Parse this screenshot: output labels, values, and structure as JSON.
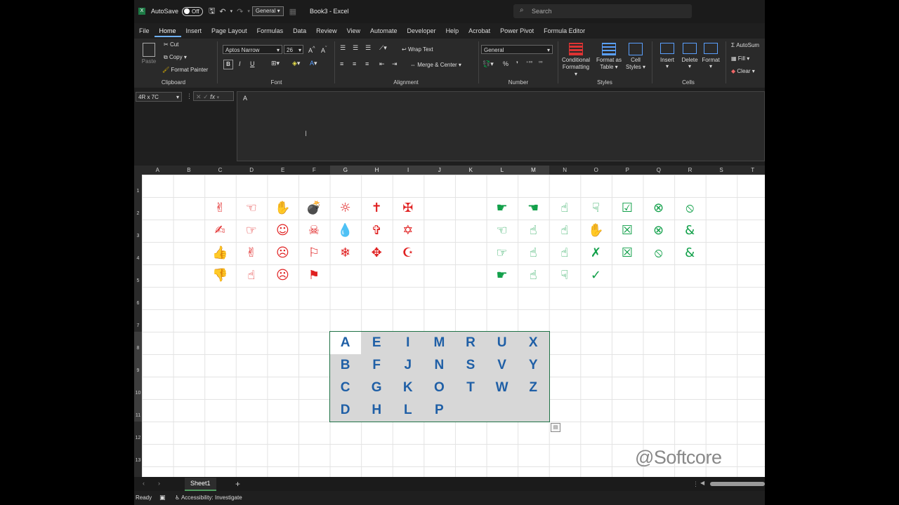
{
  "titlebar": {
    "autosave_label": "AutoSave",
    "autosave_state": "Off",
    "number_format_dropdown": "General",
    "title": "Book3 - Excel",
    "search_placeholder": "Search"
  },
  "menu_tabs": [
    "File",
    "Home",
    "Insert",
    "Page Layout",
    "Formulas",
    "Data",
    "Review",
    "View",
    "Automate",
    "Developer",
    "Help",
    "Acrobat",
    "Power Pivot",
    "Formula Editor"
  ],
  "ribbon": {
    "clipboard": {
      "paste": "Paste",
      "cut": "Cut",
      "copy": "Copy",
      "format_painter": "Format Painter",
      "label": "Clipboard"
    },
    "font": {
      "name": "Aptos Narrow",
      "size": "26",
      "bold": "B",
      "italic": "I",
      "underline": "U",
      "label": "Font"
    },
    "alignment": {
      "wrap": "Wrap Text",
      "merge": "Merge & Center",
      "label": "Alignment"
    },
    "number": {
      "format": "General",
      "label": "Number"
    },
    "styles": {
      "conditional": "Conditional Formatting",
      "format_table": "Format as Table",
      "cell_styles": "Cell Styles",
      "label": "Styles"
    },
    "cells": {
      "insert": "Insert",
      "delete": "Delete",
      "format": "Format",
      "label": "Cells"
    },
    "editing": {
      "autosum": "AutoSum",
      "fill": "Fill",
      "clear": "Clear"
    }
  },
  "formula_bar": {
    "name_box": "4R x 7C",
    "fx": "fx",
    "content": "A"
  },
  "columns": [
    "A",
    "B",
    "C",
    "D",
    "E",
    "F",
    "G",
    "H",
    "I",
    "J",
    "K",
    "L",
    "M",
    "N",
    "O",
    "P",
    "Q",
    "R",
    "S",
    "T"
  ],
  "selected_columns": [
    "G",
    "H",
    "I",
    "J",
    "K",
    "L",
    "M"
  ],
  "rows": [
    "1",
    "2",
    "3",
    "4",
    "5",
    "6",
    "7",
    "8",
    "9",
    "10",
    "11",
    "12",
    "13"
  ],
  "selected_rows": [
    "8",
    "9",
    "10",
    "11"
  ],
  "red_symbols": [
    [
      "✌",
      "☜",
      "✋",
      "💣",
      "☼",
      "✝",
      "✠"
    ],
    [
      "✍",
      "☞",
      "☺",
      "☠",
      "💧",
      "✞",
      "✡"
    ],
    [
      "👍",
      "✌",
      "☹",
      "⚐",
      "❄",
      "✥",
      "☪"
    ],
    [
      "👎",
      "☝",
      "☹",
      "⚑",
      "",
      "",
      ""
    ]
  ],
  "green_symbols": [
    [
      "☛",
      "☚",
      "☝",
      "☟",
      "☑",
      "⊗",
      "⦸"
    ],
    [
      "☜",
      "☝",
      "☝",
      "✋",
      "☒",
      "⊗",
      "&"
    ],
    [
      "☞",
      "☝",
      "☝",
      "✗",
      "☒",
      "⦸",
      "&"
    ],
    [
      "☛",
      "☝",
      "☟",
      "✓",
      "",
      "",
      ""
    ]
  ],
  "letters": [
    [
      "A",
      "E",
      "I",
      "M",
      "R",
      "U",
      "X"
    ],
    [
      "B",
      "F",
      "J",
      "N",
      "S",
      "V",
      "Y"
    ],
    [
      "C",
      "G",
      "K",
      "O",
      "T",
      "W",
      "Z"
    ],
    [
      "D",
      "H",
      "L",
      "P",
      "",
      "",
      ""
    ]
  ],
  "watermark": "@Softcore",
  "sheet": {
    "tab": "Sheet1",
    "add": "+"
  },
  "status": {
    "ready": "Ready",
    "accessibility": "Accessibility: Investigate"
  },
  "colors": {
    "red": "#e02020",
    "green": "#12a04a",
    "letter_blue": "#1f5fa6",
    "selection_border": "#1e7145"
  }
}
